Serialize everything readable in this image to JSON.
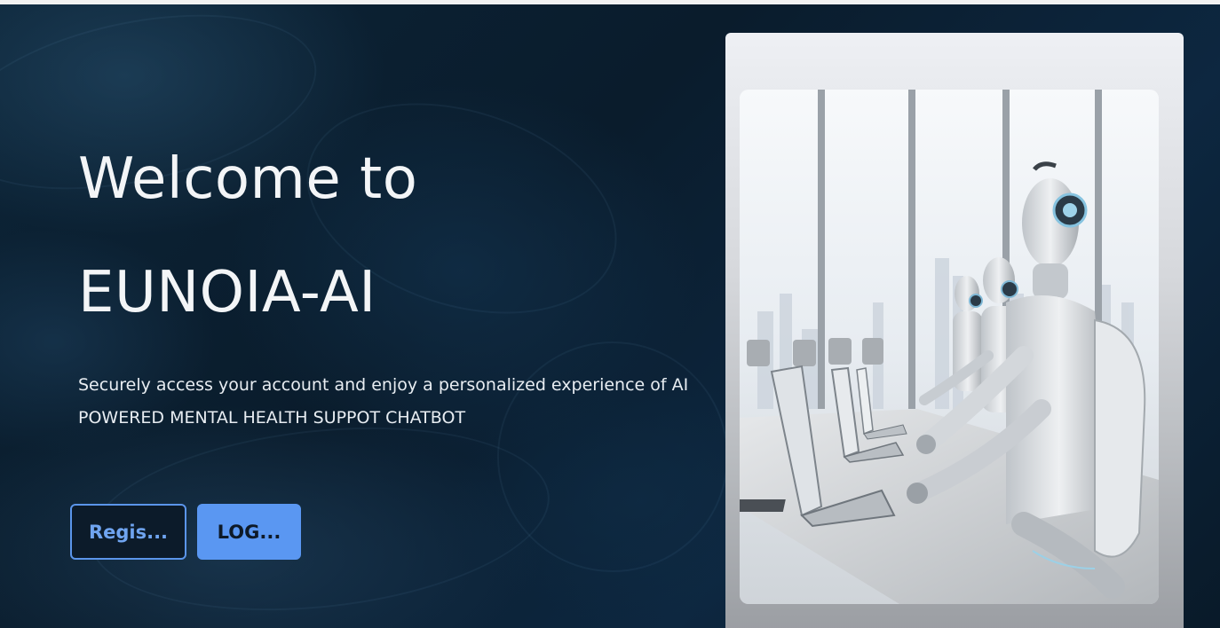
{
  "hero": {
    "title_line_1": "Welcome to",
    "title_line_2": "EUNOIA-AI",
    "subtitle_line_1": "Securely access your account and enjoy a personalized experience of AI",
    "subtitle_line_2": "POWERED MENTAL HEALTH SUPPOT CHATBOT"
  },
  "buttons": {
    "register_label": "Regis...",
    "login_label": "LOG..."
  },
  "illustration": {
    "icon": "robots-at-laptops-illustration"
  },
  "colors": {
    "background": "#0b2133",
    "accent": "#5a97f2",
    "title_text": "#f3f5f7"
  }
}
